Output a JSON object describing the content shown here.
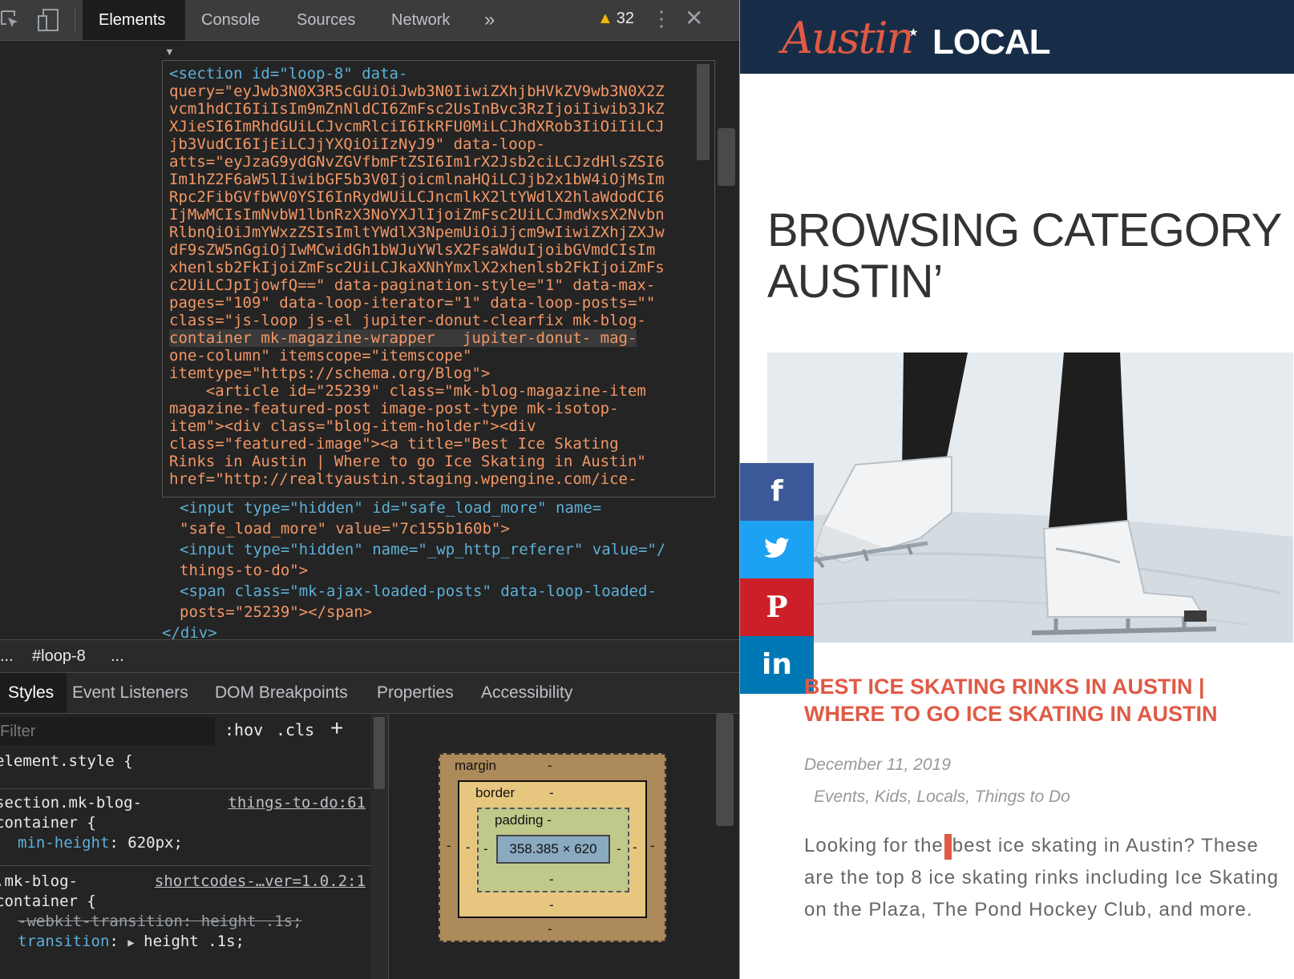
{
  "devtools": {
    "tabs": [
      "Elements",
      "Console",
      "Sources",
      "Network",
      "»"
    ],
    "active_tab": "Elements",
    "warning_count": "32",
    "breadcrumb": [
      "...",
      "#loop-8",
      "..."
    ],
    "styles_tabs": [
      "Styles",
      "Event Listeners",
      "DOM Breakpoints",
      "Properties",
      "Accessibility"
    ],
    "filter_placeholder": "Filter",
    "filter_buttons": [
      ":hov",
      ".cls",
      "+"
    ],
    "rules": {
      "r1_selector": "element.style {",
      "r2_selector_1": "section.mk-blog-",
      "r2_selector_2": "container {",
      "r2_source": "things-to-do:61",
      "r2_prop": "min-height",
      "r2_val": "620px;",
      "r3_selector_1": ".mk-blog-",
      "r3_selector_2": "container {",
      "r3_source": "shortcodes-…ver=1.0.2:1",
      "r3_prop_struck": "-webkit-transition: height .1s;",
      "r3_prop": "transition",
      "r3_val": "height .1s;"
    },
    "box_model": {
      "margin_label": "margin",
      "border_label": "border",
      "padding_label": "padding -",
      "content": "358.385 × 620",
      "dash": "-"
    },
    "dom_lines": {
      "l1a": "<input type=\"hidden\" id=\"safe_load_more\" name=",
      "l1b": "\"safe_load_more\" value=\"7c155b160b\">",
      "l2a": "<input type=\"hidden\" name=\"_wp_http_referer\" value=\"/",
      "l2b": "things-to-do\">",
      "l3a": "<span class=\"mk-ajax-loaded-posts\" data-loop-loaded-",
      "l3b": "posts=\"25239\"></span>",
      "l4": "</div>"
    },
    "tooltip_lines": [
      "<section id=\"loop-8\" data-",
      "query=\"eyJwb3N0X3R5cGUiOiJwb3N0IiwiZXhjbHVkZV9wb3N0X2Z",
      "vcm1hdCI6IiIsIm9mZnNldCI6ZmFsc2UsInBvc3RzIjoiIiwib3JkZ",
      "XJieSI6ImRhdGUiLCJvcmRlciI6IkRFU0MiLCJhdXRob3IiOiIiLCJ",
      "jb3VudCI6IjEiLCJjYXQiOiIzNyJ9\" data-loop-",
      "atts=\"eyJzaG9ydGNvZGVfbmFtZSI6Im1rX2Jsb2ciLCJzdHlsZSI6",
      "Im1hZ2F6aW5lIiwibGF5b3V0IjoicmlnaHQiLCJjb2x1bW4iOjMsIm",
      "Rpc2FibGVfbWV0YSI6InRydWUiLCJncmlkX2ltYWdlX2hlaWdodCI6",
      "IjMwMCIsImNvbW1lbnRzX3NoYXJlIjoiZmFsc2UiLCJmdWxsX2Nvbn",
      "RlbnQiOiJmYWxzZSIsImltYWdlX3NpemUiOiJjcm9wIiwiZXhjZXJw",
      "dF9sZW5nGgiOjIwMCwidGh1bWJuYWlsX2FsaWduIjoibGVmdCIsIm",
      "xhenlsb2FkIjoiZmFsc2UiLCJkaXNhYmxlX2xhenlsb2FkIjoiZmFs",
      "c2UiLCJpIjowfQ==\" data-pagination-style=\"1\" data-max-",
      "pages=\"109\" data-loop-iterator=\"1\" data-loop-posts=\"\"",
      "class=\"js-loop js-el jupiter-donut-clearfix mk-blog-",
      "container mk-magazine-wrapper   jupiter-donut- mag-",
      "one-column\" itemscope=\"itemscope\"",
      "itemtype=\"https://schema.org/Blog\">",
      "    <article id=\"25239\" class=\"mk-blog-magazine-item",
      "magazine-featured-post image-post-type mk-isotop-",
      "item\"><div class=\"blog-item-holder\"><div",
      "class=\"featured-image\"><a title=\"Best Ice Skating",
      "Rinks in Austin | Where to go Ice Skating in Austin\"",
      "href=\"http://realtyaustin.staging.wpengine.com/ice-"
    ]
  },
  "site": {
    "logo_script": "Austin",
    "logo_text": "LOCAL",
    "category_title_1": "BROWSING CATEGORY ‘",
    "category_title_2": "AUSTIN’",
    "share_buttons": [
      "f",
      "twitter",
      "P",
      "in"
    ],
    "share_colors": [
      "#3b5998",
      "#1da1f2",
      "#cb2027",
      "#0077b5"
    ],
    "post_title": "BEST ICE SKATING RINKS IN AUSTIN | WHERE TO GO ICE SKATING IN AUSTIN",
    "post_date": "December 11, 2019",
    "post_categories": "Events, Kids, Locals, Things to Do",
    "excerpt_before": "Looking for the",
    "excerpt_after": "best ice skating in Austin? These are the top 8 ice skating rinks including Ice Skating on the Plaza, The Pond Hockey Club, and more.",
    "accent_color": "#e05a45",
    "header_color": "#172d47"
  }
}
